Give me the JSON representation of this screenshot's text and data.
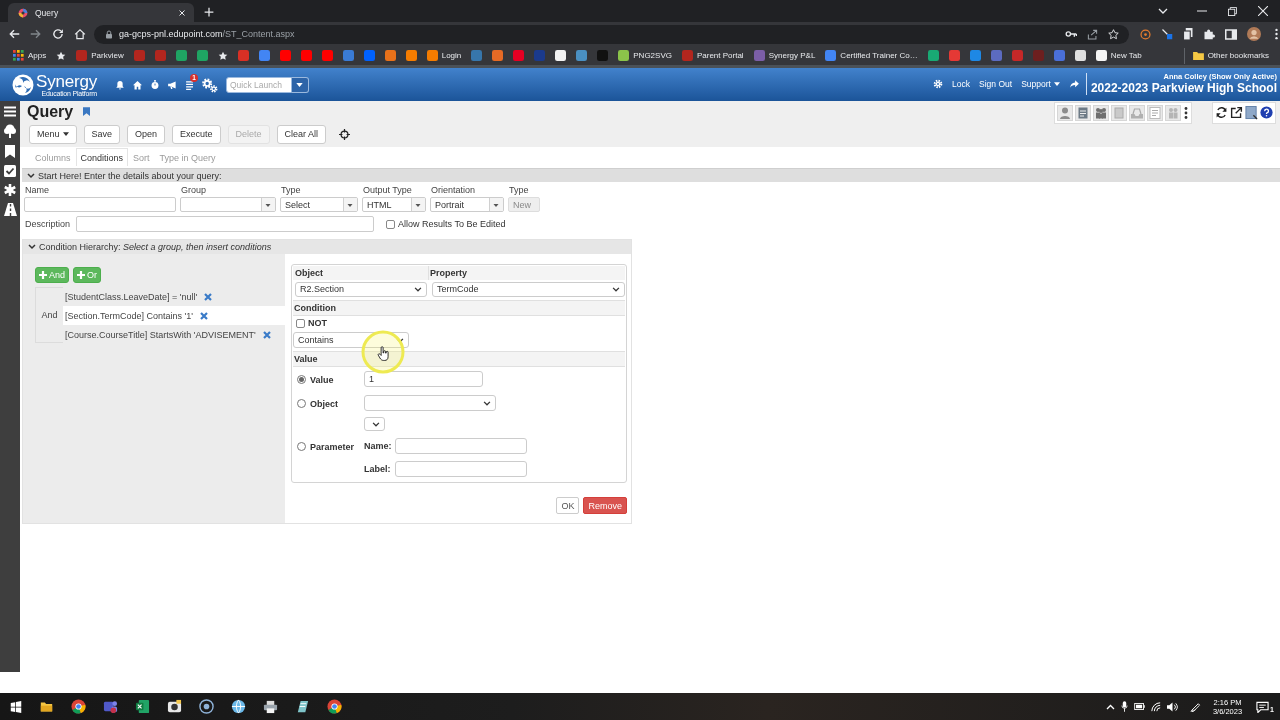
{
  "browser": {
    "tab": {
      "title": "Query"
    },
    "url": {
      "host": "ga-gcps-pnl.edupoint.com",
      "path": "/ST_Content.aspx"
    },
    "bookmarks": [
      {
        "kind": "apps",
        "label": "Apps"
      },
      {
        "kind": "star"
      },
      {
        "kind": "favicon",
        "color": "#b3261e",
        "label": "Parkview"
      },
      {
        "kind": "favicon",
        "color": "#b3261e"
      },
      {
        "kind": "favicon",
        "color": "#b3261e"
      },
      {
        "kind": "favicon",
        "color": "#1fa463"
      },
      {
        "kind": "favicon",
        "color": "#1fa463"
      },
      {
        "kind": "star"
      },
      {
        "kind": "favicon",
        "color": "#d93025"
      },
      {
        "kind": "favicon",
        "color": "#4285f4"
      },
      {
        "kind": "favicon",
        "color": "#ff0000"
      },
      {
        "kind": "favicon",
        "color": "#ff0000"
      },
      {
        "kind": "favicon",
        "color": "#ff0000"
      },
      {
        "kind": "favicon",
        "color": "#3a7bd5"
      },
      {
        "kind": "favicon",
        "color": "#0061fe"
      },
      {
        "kind": "favicon",
        "color": "#e8711a"
      },
      {
        "kind": "favicon",
        "color": "#f57c00"
      },
      {
        "kind": "favicon",
        "color": "#f57c00",
        "label": "Login"
      },
      {
        "kind": "favicon",
        "color": "#3776ab"
      },
      {
        "kind": "favicon",
        "color": "#e66a25"
      },
      {
        "kind": "favicon",
        "color": "#e60023"
      },
      {
        "kind": "favicon",
        "color": "#1b3a8c"
      },
      {
        "kind": "favicon",
        "color": "#f2f2f2"
      },
      {
        "kind": "favicon",
        "color": "#4a90c2"
      },
      {
        "kind": "favicon",
        "color": "#111111"
      },
      {
        "kind": "favicon",
        "color": "#8bc34a",
        "label": "PNG2SVG"
      },
      {
        "kind": "favicon",
        "color": "#b3261e",
        "label": "Parent Portal"
      },
      {
        "kind": "favicon",
        "color": "#7b5ea7",
        "label": "Synergy P&L"
      },
      {
        "kind": "favicon",
        "color": "#4285f4",
        "label": "Certified Trainer Co…"
      },
      {
        "kind": "favicon",
        "color": "#19a974"
      },
      {
        "kind": "favicon",
        "color": "#e53935"
      },
      {
        "kind": "favicon",
        "color": "#1e88e5"
      },
      {
        "kind": "favicon",
        "color": "#5c6bc0"
      },
      {
        "kind": "favicon",
        "color": "#c62828"
      },
      {
        "kind": "favicon",
        "color": "#6d1f1f"
      },
      {
        "kind": "favicon",
        "color": "#4a6fd8"
      },
      {
        "kind": "favicon",
        "color": "#e0e0e0"
      },
      {
        "kind": "favicon",
        "color": "#f5f5f5",
        "label": "New Tab"
      }
    ],
    "other_bookmarks": "Other bookmarks"
  },
  "header": {
    "logo": {
      "name": "Synergy",
      "tagline": "Education Platform"
    },
    "alert_count": "1",
    "quick_launch": {
      "placeholder": "Quick Launch"
    },
    "links": [
      {
        "label": "Lock",
        "kind": "link"
      },
      {
        "label": "Sign Out",
        "kind": "link"
      },
      {
        "label": "Support",
        "kind": "menu"
      }
    ],
    "user": "Anna Colley (Show Only Active)",
    "school": "2022-2023 Parkview High School"
  },
  "page": {
    "title": "Query",
    "toolbar": [
      {
        "label": "Menu",
        "kind": "menu",
        "disabled": false
      },
      {
        "label": "Save",
        "kind": "button",
        "disabled": false
      },
      {
        "label": "Open",
        "kind": "button",
        "disabled": false
      },
      {
        "label": "Execute",
        "kind": "button",
        "disabled": false
      },
      {
        "label": "Delete",
        "kind": "button",
        "disabled": true
      },
      {
        "label": "Clear All",
        "kind": "button",
        "disabled": false
      }
    ],
    "tabs": [
      {
        "label": "Columns",
        "selected": false
      },
      {
        "label": "Conditions",
        "selected": true
      },
      {
        "label": "Sort",
        "selected": false
      },
      {
        "label": "Type in Query",
        "selected": false
      }
    ],
    "details": {
      "heading": "Start Here! Enter the details about your query:",
      "expanded": true,
      "fields": [
        {
          "label": "Name",
          "kind": "text"
        },
        {
          "label": "Group",
          "kind": "select"
        },
        {
          "label": "Type",
          "kind": "select",
          "value": "Select"
        },
        {
          "label": "Output Type",
          "kind": "select",
          "value": "HTML"
        },
        {
          "label": "Orientation",
          "kind": "select",
          "value": "Portrait"
        },
        {
          "label": "Type",
          "kind": "readonly",
          "value": "New"
        }
      ],
      "description": {
        "label": "Description"
      },
      "allow_edit": {
        "label": "Allow Results To Be Edited",
        "checked": false
      }
    },
    "conditions": {
      "heading": "Condition Hierarchy: *Select a group, then insert conditions*",
      "expanded": true,
      "add_buttons": [
        "And",
        "Or"
      ],
      "group": {
        "operator": "And",
        "items": [
          {
            "text": "[StudentClass.LeaveDate] = 'null'",
            "selected": false
          },
          {
            "text": "[Section.TermCode] Contains '1'",
            "selected": true
          },
          {
            "text": "[Course.CourseTitle] StartsWith 'ADVISEMENT'",
            "selected": false
          }
        ]
      },
      "editor": {
        "object": {
          "label": "Object",
          "value": "R2.Section"
        },
        "property": {
          "label": "Property",
          "value": "TermCode"
        },
        "condition": {
          "label": "Condition",
          "negate": {
            "label": "NOT",
            "checked": false
          },
          "operator": "Contains"
        },
        "value_heading": "Value",
        "sources": [
          {
            "kind": "value",
            "label": "Value",
            "selected": true,
            "value": "1"
          },
          {
            "kind": "object",
            "label": "Object",
            "selected": false
          },
          {
            "kind": "parameter",
            "label": "Parameter",
            "selected": false,
            "name_label": "Name:",
            "label_label": "Label:"
          }
        ]
      },
      "actions": [
        {
          "label": "OK",
          "kind": "default"
        },
        {
          "label": "Remove",
          "kind": "danger"
        }
      ]
    }
  },
  "taskbar": {
    "time": "2:16 PM",
    "date": "3/6/2023",
    "notifications": "1"
  }
}
